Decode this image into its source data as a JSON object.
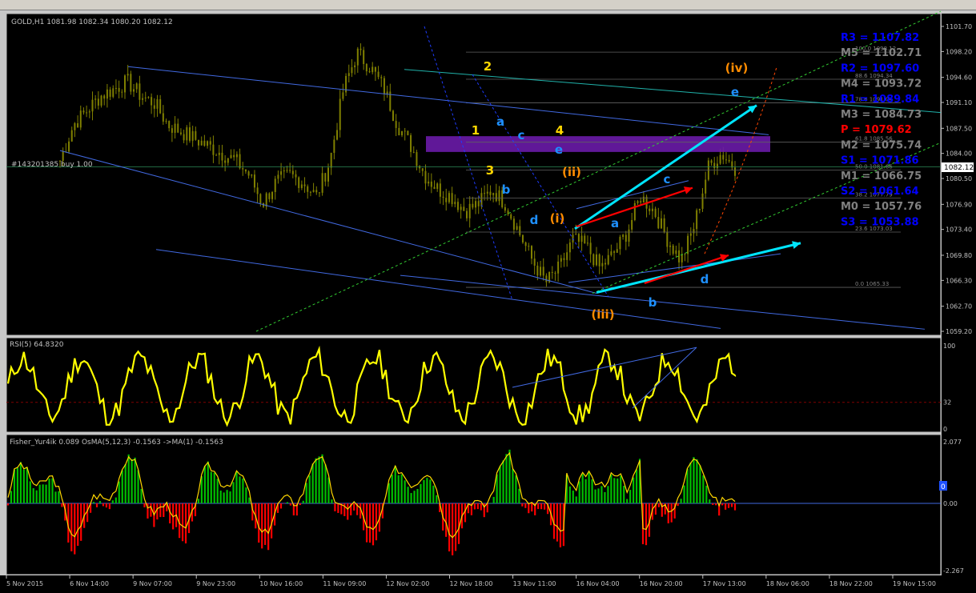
{
  "window": {
    "toolbar_visible": true
  },
  "main": {
    "header": "GOLD,H1  1081.98 1082.34 1080.20 1082.12",
    "order_label": "#143201385 buy 1.00",
    "price_ticks": [
      "1101.70",
      "1098.20",
      "1094.60",
      "1091.10",
      "1087.50",
      "1084.00",
      "1080.50",
      "1076.90",
      "1073.40",
      "1069.80",
      "1066.30",
      "1062.70",
      "1059.20"
    ],
    "current_price": "1082.12",
    "pivots": [
      {
        "text": "R3 = 1107.82",
        "color": "#0000ff"
      },
      {
        "text": "M5 = 1102.71",
        "color": "#808080"
      },
      {
        "text": "R2 = 1097.60",
        "color": "#0000ff"
      },
      {
        "text": "M4 = 1093.72",
        "color": "#808080"
      },
      {
        "text": "R1 = 1089.84",
        "color": "#0000ff"
      },
      {
        "text": "M3 = 1084.73",
        "color": "#808080"
      },
      {
        "text": "P  = 1079.62",
        "color": "#ff0000"
      },
      {
        "text": "M2 = 1075.74",
        "color": "#808080"
      },
      {
        "text": "S1 = 1071.86",
        "color": "#0000ff"
      },
      {
        "text": "M1 = 1066.75",
        "color": "#808080"
      },
      {
        "text": "S2 = 1061.64",
        "color": "#0000ff"
      },
      {
        "text": "M0 = 1057.76",
        "color": "#808080"
      },
      {
        "text": "S3 = 1053.88",
        "color": "#0000ff"
      }
    ],
    "fib_labels": [
      "100.0 1098.12",
      "88.6 1094.34",
      "78.6 1091.04",
      "61.8 1085.56",
      "50.0 1081.66",
      "38.2 1077.79",
      "23.6 1073.03",
      "0.0 1065.33"
    ],
    "wave_labels": [
      {
        "text": "2",
        "color": "#ffd700"
      },
      {
        "text": "1",
        "color": "#ffd700"
      },
      {
        "text": "3",
        "color": "#ffd700"
      },
      {
        "text": "4",
        "color": "#ffd700"
      },
      {
        "text": "a",
        "color": "#1e90ff"
      },
      {
        "text": "b",
        "color": "#1e90ff"
      },
      {
        "text": "c",
        "color": "#1e90ff"
      },
      {
        "text": "d",
        "color": "#1e90ff"
      },
      {
        "text": "e",
        "color": "#1e90ff"
      },
      {
        "text": "(i)",
        "color": "#ff8c00"
      },
      {
        "text": "(ii)",
        "color": "#ff8c00"
      },
      {
        "text": "(iii)",
        "color": "#ff8c00"
      },
      {
        "text": "(iv)",
        "color": "#ff8c00"
      },
      {
        "text": "a",
        "color": "#1e90ff"
      },
      {
        "text": "b",
        "color": "#1e90ff"
      },
      {
        "text": "c",
        "color": "#1e90ff"
      },
      {
        "text": "d",
        "color": "#1e90ff"
      },
      {
        "text": "e",
        "color": "#1e90ff"
      }
    ],
    "time_labels": [
      "5 Nov 2015",
      "6 Nov 14:00",
      "9 Nov 07:00",
      "9 Nov 23:00",
      "10 Nov 16:00",
      "11 Nov 09:00",
      "12 Nov 02:00",
      "12 Nov 18:00",
      "13 Nov 11:00",
      "16 Nov 04:00",
      "16 Nov 20:00",
      "17 Nov 13:00",
      "18 Nov 06:00",
      "18 Nov 22:00",
      "19 Nov 15:00"
    ]
  },
  "rsi": {
    "header": "RSI(5) 64.8320",
    "ticks": [
      "100",
      "32",
      "0"
    ]
  },
  "fisher": {
    "header": "Fisher_Yur4ik 0.089  OsMA(5,12,3) -0.1563  ->MA(1) -0.1563",
    "ticks": [
      "2.077",
      "0.00",
      "-2.267"
    ],
    "marker": "0"
  },
  "chart_data": [
    {
      "type": "candlestick",
      "title": "GOLD,H1",
      "ylim": [
        1059.2,
        1101.7
      ],
      "grid": false,
      "close_path": [
        1083,
        1088,
        1090,
        1092,
        1093,
        1094,
        1092,
        1091,
        1088,
        1087,
        1086,
        1085,
        1084,
        1083,
        1081,
        1077,
        1080,
        1081,
        1080,
        1078,
        1083,
        1093,
        1098,
        1096,
        1093,
        1088,
        1085,
        1081,
        1079,
        1078,
        1076,
        1077,
        1079,
        1077,
        1073,
        1069,
        1066,
        1068,
        1072,
        1071,
        1068,
        1070,
        1073,
        1078,
        1076,
        1072,
        1069,
        1074,
        1082,
        1084,
        1082
      ]
    },
    {
      "type": "line",
      "title": "RSI(5)",
      "ylim": [
        0,
        100
      ],
      "last": 64.832,
      "level": 32
    },
    {
      "type": "bar",
      "title": "Fisher_Yur4ik",
      "ylim": [
        -2.267,
        2.077
      ],
      "last": 0.089
    }
  ],
  "colors": {
    "bg": "#000000",
    "axis": "#c0c0c0",
    "candle": "#808000",
    "rsi": "#ffff00",
    "hist_up": "#00c000",
    "hist_down": "#ff0000",
    "channel": "#4169e1",
    "cyan": "#00e5ff",
    "red_arrow": "#ff0000",
    "purple_zone": "#6a1ba8"
  }
}
